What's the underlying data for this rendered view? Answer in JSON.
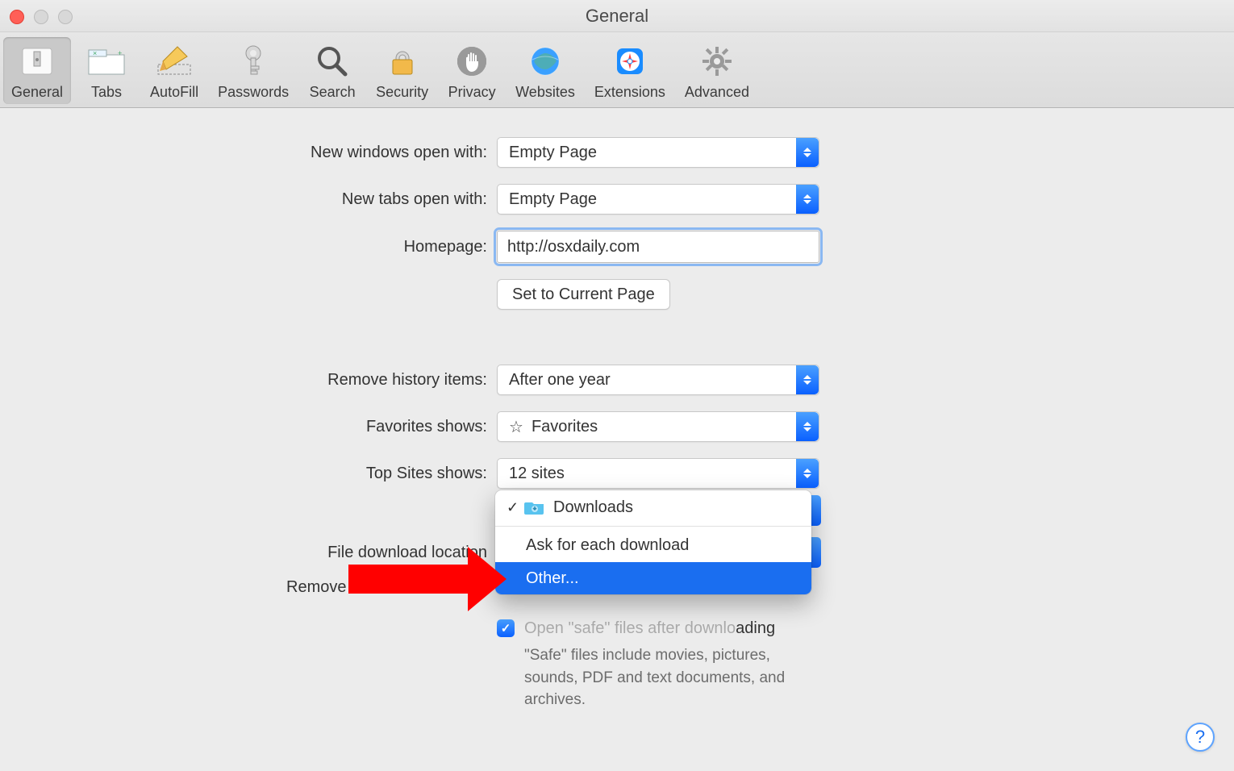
{
  "window": {
    "title": "General"
  },
  "toolbar": {
    "items": [
      {
        "label": "General"
      },
      {
        "label": "Tabs"
      },
      {
        "label": "AutoFill"
      },
      {
        "label": "Passwords"
      },
      {
        "label": "Search"
      },
      {
        "label": "Security"
      },
      {
        "label": "Privacy"
      },
      {
        "label": "Websites"
      },
      {
        "label": "Extensions"
      },
      {
        "label": "Advanced"
      }
    ]
  },
  "form": {
    "new_windows_label": "New windows open with:",
    "new_windows_value": "Empty Page",
    "new_tabs_label": "New tabs open with:",
    "new_tabs_value": "Empty Page",
    "homepage_label": "Homepage:",
    "homepage_value": "http://osxdaily.com",
    "set_current_button": "Set to Current Page",
    "remove_history_label": "Remove history items:",
    "remove_history_value": "After one year",
    "favorites_label": "Favorites shows:",
    "favorites_value": "Favorites",
    "topsites_label": "Top Sites shows:",
    "topsites_value": "12 sites",
    "download_location_label": "File download location",
    "remove_downloads_label": "Remove download list items",
    "open_safe_label": "Open \"safe\" files after downloading",
    "safe_note": "\"Safe\" files include movies, pictures, sounds, PDF and text documents, and archives."
  },
  "dropdown": {
    "items": [
      {
        "label": "Downloads",
        "checked": true,
        "folder": true
      },
      {
        "label": "Ask for each download"
      },
      {
        "label": "Other...",
        "highlight": true
      }
    ]
  },
  "help_button": "?"
}
